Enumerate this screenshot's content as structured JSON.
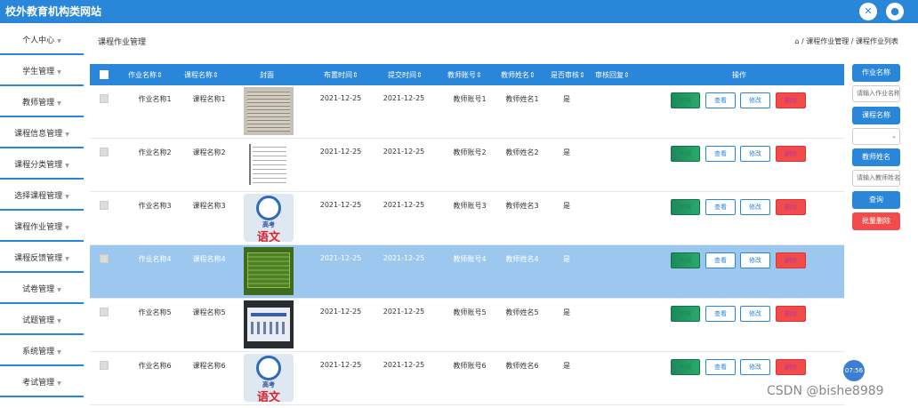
{
  "app": {
    "title": "校外教育机构类网站"
  },
  "sidebar": {
    "items": [
      {
        "label": "个人中心"
      },
      {
        "label": "学生管理"
      },
      {
        "label": "教师管理"
      },
      {
        "label": "课程信息管理"
      },
      {
        "label": "课程分类管理"
      },
      {
        "label": "选择课程管理"
      },
      {
        "label": "课程作业管理"
      },
      {
        "label": "课程反馈管理"
      },
      {
        "label": "试卷管理"
      },
      {
        "label": "试题管理"
      },
      {
        "label": "系统管理"
      },
      {
        "label": "考试管理"
      }
    ]
  },
  "page": {
    "title": "课程作业管理",
    "breadcrumb": "/ 课程作业管理 / 课程作业列表"
  },
  "table": {
    "headers": [
      "作业名称",
      "课程名称",
      "封面",
      "布置时间",
      "提交时间",
      "教师账号",
      "教师姓名",
      "是否审核",
      "审核回复",
      "操作"
    ],
    "rows": [
      {
        "hw": "作业名称1",
        "course": "课程名称1",
        "assigned": "2021-12-25",
        "submitted": "2021-12-25",
        "acct": "教师账号1",
        "name": "教师姓名1",
        "audit": "是",
        "cover": "doc"
      },
      {
        "hw": "作业名称2",
        "course": "课程名称2",
        "assigned": "2021-12-25",
        "submitted": "2021-12-25",
        "acct": "教师账号2",
        "name": "教师姓名2",
        "audit": "是",
        "cover": "mindmap"
      },
      {
        "hw": "作业名称3",
        "course": "课程名称3",
        "assigned": "2021-12-25",
        "submitted": "2021-12-25",
        "acct": "教师账号3",
        "name": "教师姓名3",
        "audit": "是",
        "cover": "yuwen"
      },
      {
        "hw": "作业名称4",
        "course": "课程名称4",
        "assigned": "2021-12-25",
        "submitted": "2021-12-25",
        "acct": "教师账号4",
        "name": "教师姓名4",
        "audit": "是",
        "cover": "green"
      },
      {
        "hw": "作业名称5",
        "course": "课程名称5",
        "assigned": "2021-12-25",
        "submitted": "2021-12-25",
        "acct": "教师账号5",
        "name": "教师姓名5",
        "audit": "是",
        "cover": "dark"
      },
      {
        "hw": "作业名称6",
        "course": "课程名称6",
        "assigned": "2021-12-25",
        "submitted": "2021-12-25",
        "acct": "教师账号6",
        "name": "教师姓名6",
        "audit": "是",
        "cover": "yuwen"
      }
    ],
    "actions": {
      "green": "审核",
      "view": "查看",
      "edit": "修改",
      "del": "删除"
    },
    "cover_text": {
      "top": "高考",
      "bottom": "语文"
    }
  },
  "filters": {
    "hw_label": "作业名称",
    "hw_placeholder": "请输入作业名称",
    "course_label": "课程名称",
    "teacher_label": "教师姓名",
    "teacher_placeholder": "请输入教师姓名",
    "search_label": "查询",
    "batch_delete_label": "批量删除"
  },
  "float_clock": "07:56",
  "watermark": "CSDN @bishe8989"
}
